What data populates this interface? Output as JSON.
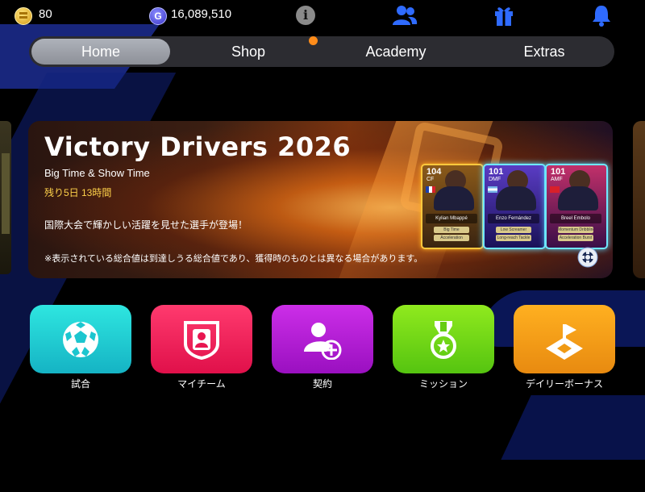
{
  "currency": {
    "coins": "80",
    "gp": "16,089,510",
    "gp_symbol": "G"
  },
  "top_icons": [
    "info-icon",
    "friends-icon",
    "gift-icon",
    "bell-icon"
  ],
  "info_symbol": "i",
  "nav": {
    "tabs": [
      {
        "label": "Home",
        "active": true
      },
      {
        "label": "Shop",
        "active": false
      },
      {
        "label": "Academy",
        "active": false,
        "notification": true
      },
      {
        "label": "Extras",
        "active": false
      }
    ]
  },
  "banner": {
    "title": "Victory Drivers 2026",
    "subtitle": "Big Time & Show Time",
    "time_left": "残り5日 13時間",
    "description": "国際大会で輝かしい活躍を見せた選手が登場！",
    "note": "※表示されている総合値は到達しうる総合値であり、獲得時のものとは異なる場合があります。",
    "cards": [
      {
        "rating": "104",
        "position": "CF",
        "name": "Kylian Mbappé",
        "skill_a": "Big Time",
        "skill_b": "Acceleration"
      },
      {
        "rating": "101",
        "position": "DMF",
        "name": "Enzo Fernández",
        "skill_a": "Low Screamer",
        "skill_b": "Long-reach Tackle"
      },
      {
        "rating": "101",
        "position": "AMF",
        "name": "Breel Embolo",
        "skill_a": "Momentum Dribbling",
        "skill_b": "Acceleration Burst"
      }
    ]
  },
  "menu": [
    {
      "label": "試合",
      "icon": "soccer-ball-icon",
      "color": "#1fcdd2"
    },
    {
      "label": "マイチーム",
      "icon": "team-badge-icon",
      "color": "#f0205a"
    },
    {
      "label": "契約",
      "icon": "add-player-icon",
      "color": "#b21ed4"
    },
    {
      "label": "ミッション",
      "icon": "medal-icon",
      "color": "#72d416"
    },
    {
      "label": "デイリーボーナス",
      "icon": "flag-pin-icon",
      "color": "#f49c18"
    }
  ],
  "colors": {
    "accent_blue": "#2f6bff",
    "notification": "#ff8c1a",
    "time_text": "#ffd24a"
  }
}
